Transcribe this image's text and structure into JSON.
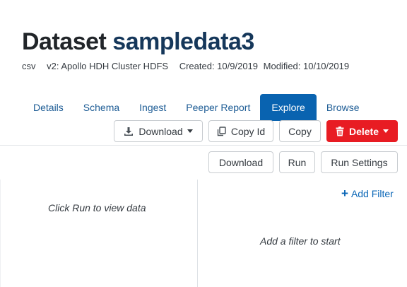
{
  "header": {
    "title_prefix": "Dataset",
    "dataset_name": "sampledata3",
    "meta": {
      "format": "csv",
      "version": "v2: Apollo HDH Cluster HDFS",
      "created": "Created: 10/9/2019",
      "modified": "Modified: 10/10/2019"
    }
  },
  "tabs": [
    {
      "label": "Details",
      "active": false
    },
    {
      "label": "Schema",
      "active": false
    },
    {
      "label": "Ingest",
      "active": false
    },
    {
      "label": "Peeper Report",
      "active": false
    },
    {
      "label": "Explore",
      "active": true
    },
    {
      "label": "Browse",
      "active": false
    }
  ],
  "actions": {
    "download_label": "Download",
    "copy_id_label": "Copy Id",
    "copy_label": "Copy",
    "delete_label": "Delete"
  },
  "explore_toolbar": {
    "download_label": "Download",
    "run_label": "Run",
    "run_settings_label": "Run Settings"
  },
  "results": {
    "empty_hint": "Click Run to view data"
  },
  "filters": {
    "add_label": "Add Filter",
    "empty_hint": "Add a filter to start"
  },
  "colors": {
    "accent": "#0963b0",
    "danger": "#e81c23",
    "title_dataset": "#15375a",
    "link": "#1d5c95"
  },
  "icons": {
    "download": "download-icon",
    "copy": "copy-icon",
    "trash": "trash-icon",
    "add": "plus-icon"
  }
}
